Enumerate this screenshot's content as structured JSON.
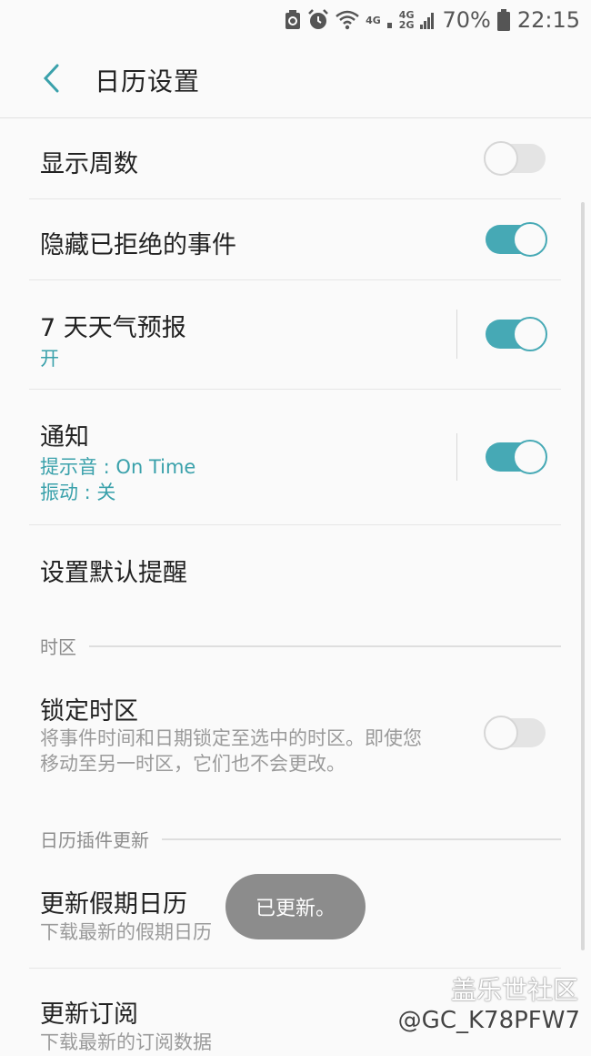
{
  "status_bar": {
    "net1": "4G",
    "net2a": "4G",
    "net2b": "2G",
    "battery": "70%",
    "time": "22:15"
  },
  "header": {
    "title": "日历设置"
  },
  "settings": {
    "show_week": {
      "title": "显示周数",
      "enabled": false
    },
    "hide_declined": {
      "title": "隐藏已拒绝的事件",
      "enabled": true
    },
    "weather": {
      "title": "7 天天气预报",
      "status": "开",
      "enabled": true
    },
    "notifications": {
      "title": "通知",
      "sound": "提示音 : On Time",
      "vibrate": "振动 : 关",
      "enabled": true
    },
    "default_reminder": {
      "title": "设置默认提醒"
    }
  },
  "timezone_section": {
    "header": "时区",
    "lock": {
      "title": "锁定时区",
      "desc_line1": "将事件时间和日期锁定至选中的时区。即使您",
      "desc_line2": "移动至另一时区，它们也不会更改。",
      "enabled": false
    }
  },
  "plugin_section": {
    "header": "日历插件更新",
    "holiday": {
      "title": "更新假期日历",
      "desc": "下载最新的假期日历"
    },
    "subscription": {
      "title": "更新订阅",
      "desc": "下载最新的订阅数据"
    }
  },
  "toast": "已更新。",
  "watermark": {
    "line1": "盖乐世社区",
    "line2": "@GC_K78PFW7"
  },
  "colors": {
    "accent": "#46a9b5",
    "accent_text": "#3aa1ab"
  }
}
